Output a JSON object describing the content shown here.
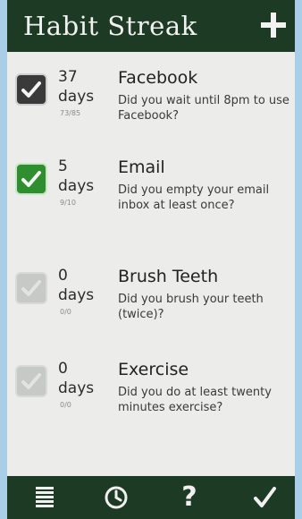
{
  "app": {
    "title": "Habit Streak"
  },
  "header": {
    "add_icon": "plus-icon"
  },
  "habits": [
    {
      "name": "Facebook",
      "question": "Did you wait until 8pm to use Facebook?",
      "count": "37",
      "unit": "days",
      "ratio": "73/85",
      "checkbox_state": "checked-dark"
    },
    {
      "name": "Email",
      "question": "Did you empty your email inbox at least once?",
      "count": "5",
      "unit": "days",
      "ratio": "9/10",
      "checkbox_state": "checked-green"
    },
    {
      "name": "Brush Teeth",
      "question": "Did you brush your teeth (twice)?",
      "count": "0",
      "unit": "days",
      "ratio": "0/0",
      "checkbox_state": "checked-faded"
    },
    {
      "name": "Exercise",
      "question": "Did you do at least twenty minutes exercise?",
      "count": "0",
      "unit": "days",
      "ratio": "0/0",
      "checkbox_state": "checked-faded"
    }
  ],
  "bottom_bar": {
    "buttons": [
      {
        "icon": "list-icon"
      },
      {
        "icon": "clock-icon"
      },
      {
        "icon": "help-icon",
        "label": "?"
      },
      {
        "icon": "checkmark-icon"
      }
    ]
  },
  "colors": {
    "header_bg": "#1d3a24",
    "screen_bg": "#ececea",
    "outer_bg": "#a9cfe8",
    "checkbox_dark": "#3a3a3a",
    "checkbox_green": "#2f8f2f",
    "checkbox_faded": "#c6c9c6"
  }
}
